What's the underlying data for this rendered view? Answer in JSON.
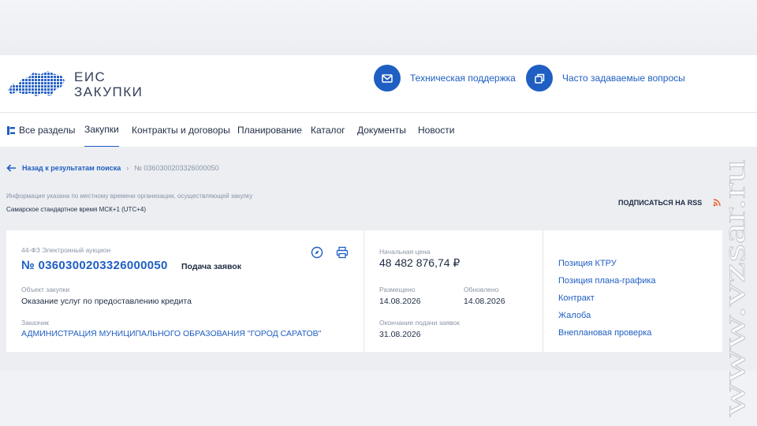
{
  "header": {
    "logo_line1": "ЕИС",
    "logo_line2": "ЗАКУПКИ",
    "support": "Техническая поддержка",
    "faq": "Часто задаваемые вопросы"
  },
  "nav": {
    "all_sections": "Все разделы",
    "items": [
      "Закупки",
      "Контракты и договоры",
      "Планирование",
      "Каталог",
      "Документы",
      "Новости"
    ]
  },
  "breadcrumb": {
    "back": "Назад к результатам поиска",
    "separator": "›",
    "current": "№ 0360300203326000050"
  },
  "info": {
    "line1": "Информация указана по местному времени организации, осуществляющей закупку",
    "line2": "Самарское стандартное время МСК+1 (UTC+4)",
    "rss": "ПОДПИСАТЬСЯ НА RSS"
  },
  "purchase": {
    "law": "44-ФЗ  Электронный аукцион",
    "number": "№ 0360300203326000050",
    "status": "Подача заявок",
    "object_label": "Объект закупки",
    "object_value": "Оказание услуг по предоставлению кредита",
    "customer_label": "Заказчик",
    "customer_value": "АДМИНИСТРАЦИЯ МУНИЦИПАЛЬНОГО ОБРАЗОВАНИЯ \"ГОРОД САРАТОВ\"",
    "price_label": "Начальная цена",
    "price_value": "48 482 876,74 ₽",
    "published_label": "Размещено",
    "published_value": "14.08.2026",
    "updated_label": "Обновлено",
    "updated_value": "14.08.2026",
    "end_label": "Окончание подачи заявок",
    "end_value": "31.08.2026"
  },
  "links": [
    "Позиция КТРУ",
    "Позиция плана-графика",
    "Контракт",
    "Жалоба",
    "Внеплановая проверка"
  ],
  "watermark": "www.vzsar.ru",
  "colors": {
    "accent": "#1f5ec2",
    "text": "#1f2c44",
    "muted": "#8a94a6",
    "rss": "#ef5a24"
  },
  "icons": [
    "russia-map-logo-icon",
    "envelope-icon",
    "copy-icon",
    "hierarchy-icon",
    "arrow-left-icon",
    "rss-icon",
    "compass-icon",
    "printer-icon"
  ]
}
